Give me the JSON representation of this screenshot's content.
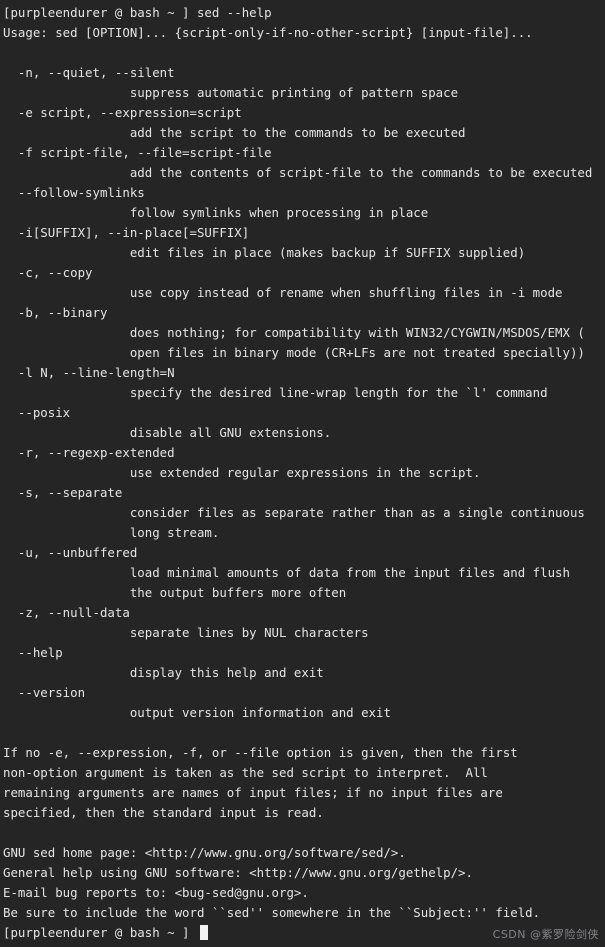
{
  "window": {
    "title": "bash terminal",
    "background_color": "#252526",
    "foreground_color": "#e4e4e4",
    "cursor_color": "#f2f2f2"
  },
  "terminal": {
    "prompt_top": "[purpleendurer @ bash ~ ] sed --help",
    "lines": [
      "[purpleendurer @ bash ~ ] sed --help",
      "Usage: sed [OPTION]... {script-only-if-no-other-script} [input-file]...",
      "",
      "  -n, --quiet, --silent",
      "                 suppress automatic printing of pattern space",
      "  -e script, --expression=script",
      "                 add the script to the commands to be executed",
      "  -f script-file, --file=script-file",
      "                 add the contents of script-file to the commands to be executed",
      "  --follow-symlinks",
      "                 follow symlinks when processing in place",
      "  -i[SUFFIX], --in-place[=SUFFIX]",
      "                 edit files in place (makes backup if SUFFIX supplied)",
      "  -c, --copy",
      "                 use copy instead of rename when shuffling files in -i mode",
      "  -b, --binary",
      "                 does nothing; for compatibility with WIN32/CYGWIN/MSDOS/EMX (",
      "                 open files in binary mode (CR+LFs are not treated specially))",
      "  -l N, --line-length=N",
      "                 specify the desired line-wrap length for the `l' command",
      "  --posix",
      "                 disable all GNU extensions.",
      "  -r, --regexp-extended",
      "                 use extended regular expressions in the script.",
      "  -s, --separate",
      "                 consider files as separate rather than as a single continuous",
      "                 long stream.",
      "  -u, --unbuffered",
      "                 load minimal amounts of data from the input files and flush",
      "                 the output buffers more often",
      "  -z, --null-data",
      "                 separate lines by NUL characters",
      "  --help",
      "                 display this help and exit",
      "  --version",
      "                 output version information and exit",
      "",
      "If no -e, --expression, -f, or --file option is given, then the first",
      "non-option argument is taken as the sed script to interpret.  All",
      "remaining arguments are names of input files; if no input files are",
      "specified, then the standard input is read.",
      "",
      "GNU sed home page: <http://www.gnu.org/software/sed/>.",
      "General help using GNU software: <http://www.gnu.org/gethelp/>.",
      "E-mail bug reports to: <bug-sed@gnu.org>.",
      "Be sure to include the word ``sed'' somewhere in the ``Subject:'' field."
    ],
    "prompt_bottom": "[purpleendurer @ bash ~ ] "
  },
  "watermark": {
    "text": "CSDN @紫罗险剑侠"
  }
}
